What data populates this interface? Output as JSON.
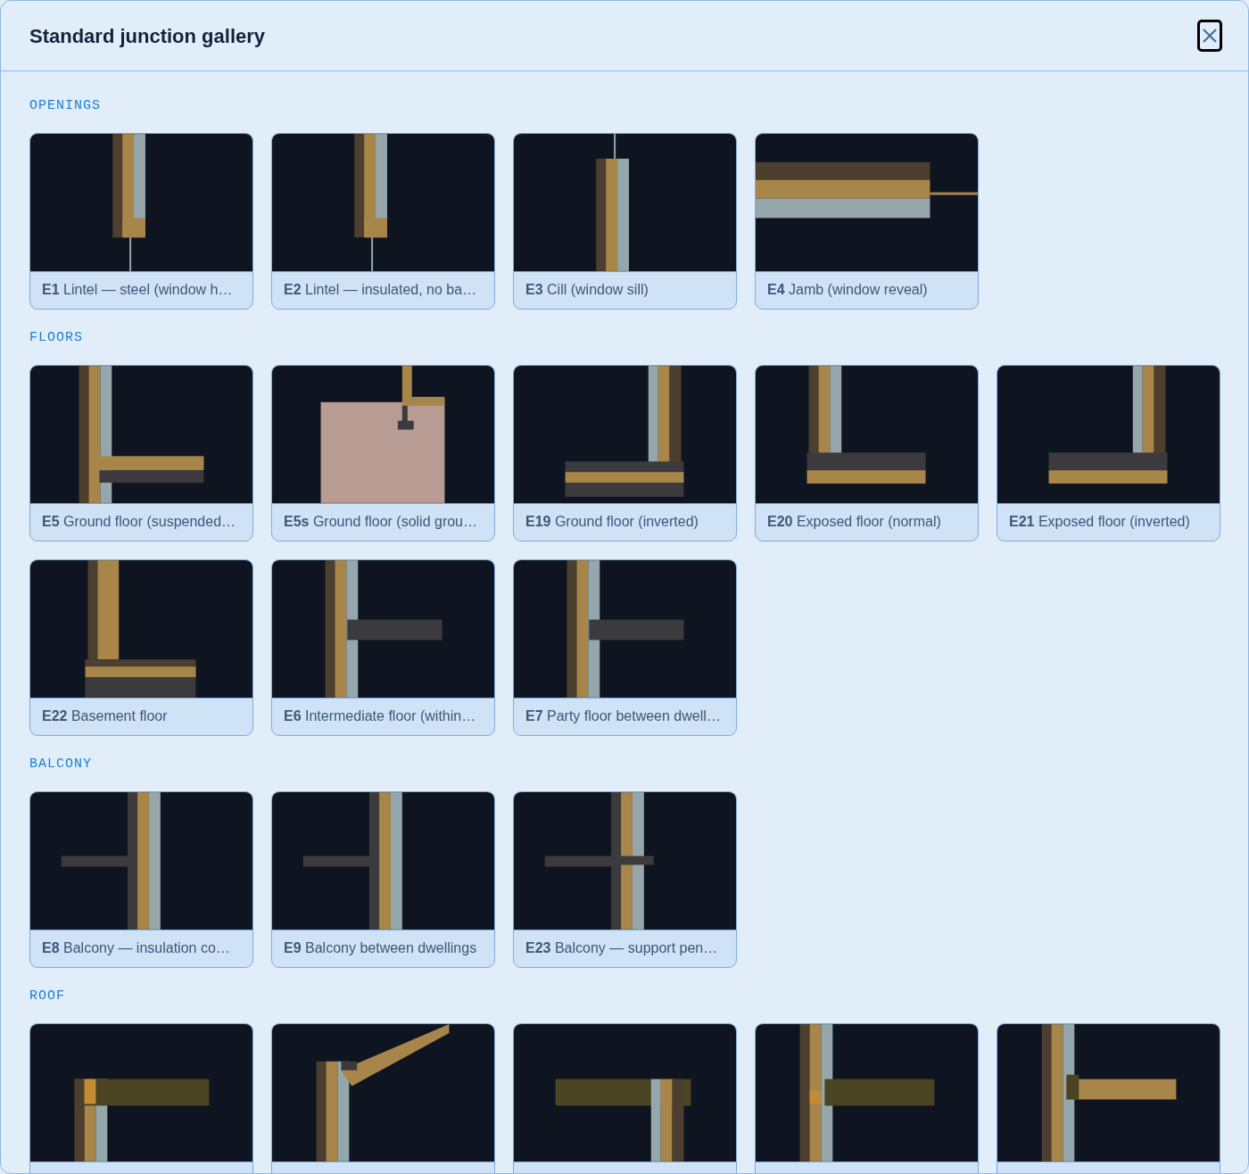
{
  "dialog": {
    "title": "Standard junction gallery"
  },
  "sections": [
    {
      "heading": "OPENINGS",
      "cards": [
        {
          "kind": "junction",
          "label": "**E1** Lintel — steel (window h…"
        },
        {
          "kind": "junction",
          "label": "**E2** Lintel — insulated, no ba…"
        },
        {
          "kind": "junction",
          "label": "**E3** Cill (window sill)"
        },
        {
          "kind": "junction",
          "label": "**E4** Jamb (window reveal)"
        }
      ]
    },
    {
      "heading": "FLOORS",
      "cards": [
        {
          "kind": "junction",
          "label": "**E5** Ground floor (suspended…"
        },
        {
          "kind": "junction",
          "label": "**E5s** Ground floor (solid grou…"
        },
        {
          "kind": "junction",
          "label": "**E19** Ground floor (inverted)"
        },
        {
          "kind": "junction",
          "label": "**E20** Exposed floor (normal)"
        },
        {
          "kind": "junction",
          "label": "**E21** Exposed floor (inverted)"
        },
        {
          "kind": "junction",
          "label": "**E22** Basement floor"
        },
        {
          "kind": "junction",
          "label": "**E6** Intermediate floor (within…"
        },
        {
          "kind": "junction",
          "label": "**E7** Party floor between dwell…"
        }
      ]
    },
    {
      "heading": "BALCONY",
      "cards": [
        {
          "kind": "junction",
          "label": "**E8** Balcony — insulation co…"
        },
        {
          "kind": "junction",
          "label": "**E9** Balcony between dwellings"
        },
        {
          "kind": "junction",
          "label": "**E23** Balcony — support pen…"
        }
      ]
    },
    {
      "heading": "ROOF",
      "cards": [
        {
          "kind": "junction"
        },
        {
          "kind": "junction"
        },
        {
          "kind": "junction"
        },
        {
          "kind": "junction"
        },
        {
          "kind": "junction"
        }
      ]
    }
  ]
}
